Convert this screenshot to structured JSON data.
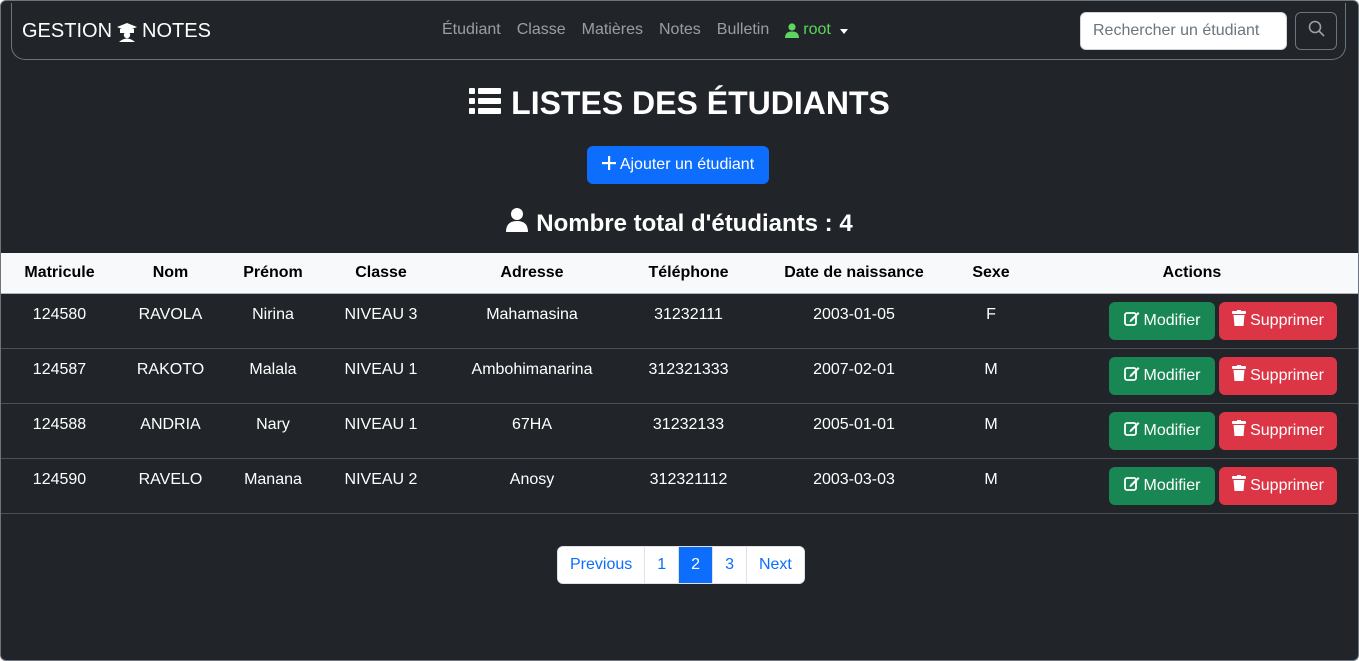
{
  "navbar": {
    "brand_left": "GESTION",
    "brand_right": "NOTES",
    "links": [
      "Étudiant",
      "Classe",
      "Matières",
      "Notes",
      "Bulletin"
    ],
    "user": "root",
    "search_placeholder": "Rechercher un étudiant"
  },
  "page": {
    "title": "LISTES DES ÉTUDIANTS",
    "add_button": "Ajouter un étudiant",
    "total_label": "Nombre total d'étudiants : 4"
  },
  "table": {
    "headers": [
      "Matricule",
      "Nom",
      "Prénom",
      "Classe",
      "Adresse",
      "Téléphone",
      "Date de naissance",
      "Sexe",
      "Actions"
    ],
    "rows": [
      [
        "124580",
        "RAVOLA",
        "Nirina",
        "NIVEAU 3",
        "Mahamasina",
        "31232111",
        "2003-01-05",
        "F"
      ],
      [
        "124587",
        "RAKOTO",
        "Malala",
        "NIVEAU 1",
        "Ambohimanarina",
        "312321333",
        "2007-02-01",
        "M"
      ],
      [
        "124588",
        "ANDRIA",
        "Nary",
        "NIVEAU 1",
        "67HA",
        "31232133",
        "2005-01-01",
        "M"
      ],
      [
        "124590",
        "RAVELO",
        "Manana",
        "NIVEAU 2",
        "Anosy",
        "312321112",
        "2003-03-03",
        "M"
      ]
    ],
    "edit_label": "Modifier",
    "delete_label": "Supprimer"
  },
  "pagination": {
    "previous": "Previous",
    "pages": [
      "1",
      "2",
      "3"
    ],
    "active_page": "2",
    "next": "Next"
  },
  "colors": {
    "background": "#212529",
    "primary": "#0d6efd",
    "success": "#198754",
    "danger": "#dc3545",
    "user_green": "#5cd65c"
  },
  "icons": {
    "brand": "graduation-cap-icon",
    "user": "user-icon",
    "search": "search-icon",
    "title": "list-icon",
    "add": "plus-icon",
    "total": "user-icon",
    "edit": "edit-icon",
    "delete": "trash-icon"
  }
}
